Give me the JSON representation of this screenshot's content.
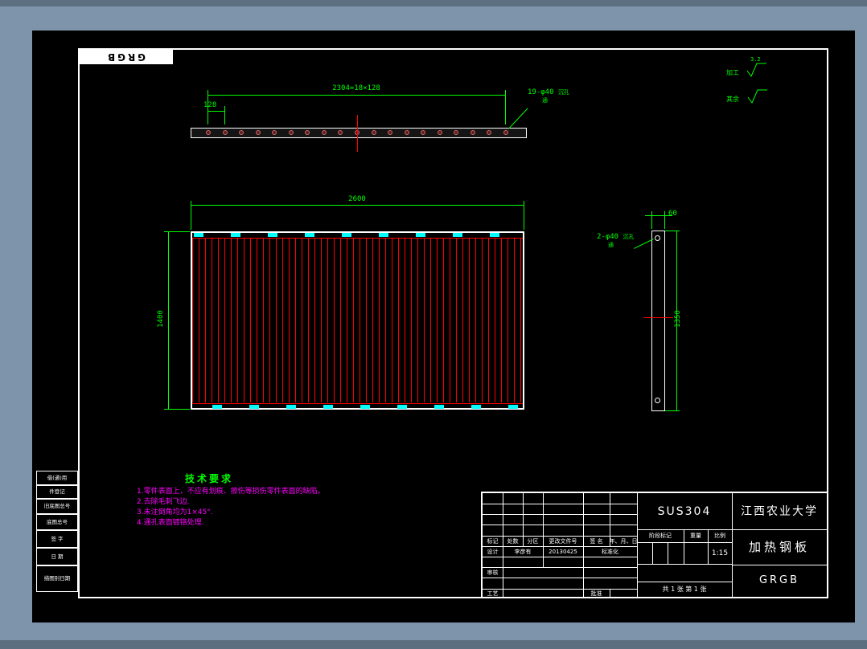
{
  "colors": {
    "bg": "#7E94AA",
    "chrome": "#5C6F80",
    "canvas": "#000000",
    "line": "#FFFFFF",
    "dim": "#00FF00",
    "note": "#FF00FF",
    "red": "#FF0000",
    "cyan": "#00FFFF",
    "hole": "#CC6666"
  },
  "stamp": {
    "label": "GRGB"
  },
  "left_panel": {
    "cells": [
      "借(通)用",
      "件登记",
      "旧底图总号",
      "底图总号",
      "签 字",
      "日 期",
      "描图别日期"
    ]
  },
  "top_view": {
    "hole_count": 19,
    "dim_total": "2304=18×128",
    "dim_pitch": "128",
    "hole_note": "19-φ40",
    "hole_note_sub1": "沉孔",
    "hole_note_sub2": "通"
  },
  "front_view": {
    "dim_width": "2600",
    "dim_height": "1400"
  },
  "side_view": {
    "dim_width": "60",
    "dim_height": "1350",
    "hole_note": "2-φ40",
    "hole_note_sub1": "沉孔",
    "hole_note_sub2": "通"
  },
  "finish": {
    "machined_label": "加工",
    "machined_value": "3.2",
    "rest_label": "其余"
  },
  "tech_requirements": {
    "title": "技术要求",
    "items": [
      "1.零件表面上，不应有划痕、擦伤等损伤零件表面的缺陷。",
      "2.去除毛刺飞边.",
      "3.未注倒角均为1×45°.",
      "4.通孔表面镀铬处理."
    ]
  },
  "title_block": {
    "material": "SUS304",
    "organization": "江西农业大学",
    "part_name": "加热钢板",
    "drawing_code": "GRGB",
    "rev_headers": [
      "标记",
      "处数",
      "分区",
      "更改文件号",
      "签 名",
      "年、月、日"
    ],
    "design_label": "设计",
    "designer": "李彦有",
    "design_date": "20130425",
    "standard_label": "标准化",
    "review_label": "审核",
    "process_label": "工艺",
    "approve_label": "批准",
    "stage_label": "阶段标记",
    "weight_label": "重量",
    "scale_label": "比例",
    "scale_value": "1:15",
    "sheet_info": "共 1 张  第 1 张"
  }
}
